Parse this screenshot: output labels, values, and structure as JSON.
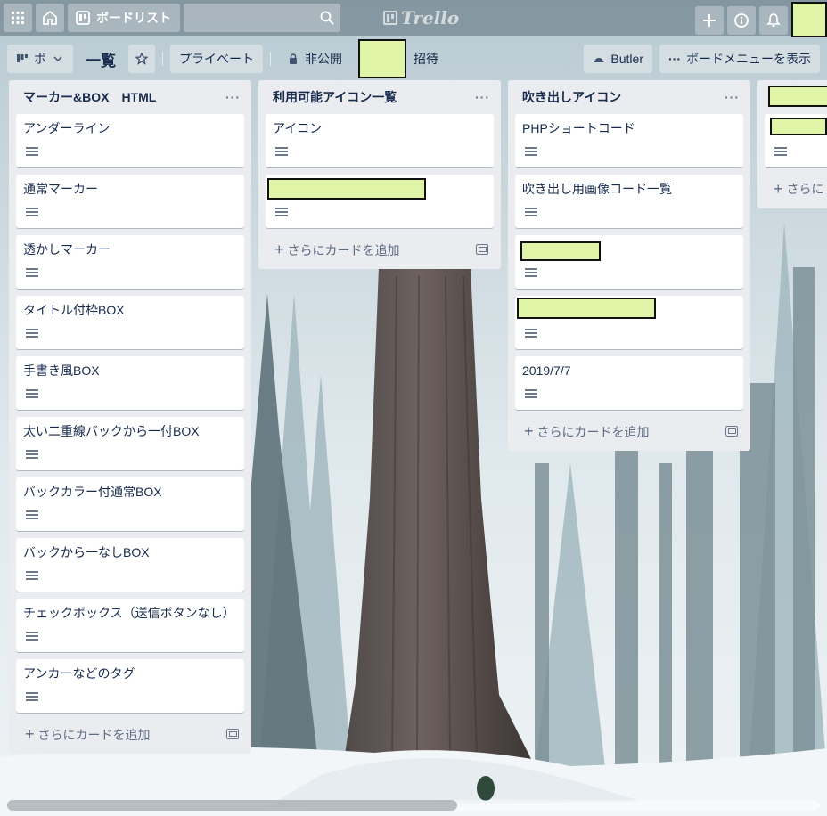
{
  "header": {
    "boards_label": "ボードリスト",
    "logo_text": "Trello"
  },
  "board": {
    "view_label": "ボ",
    "title": "一覧",
    "team_label": "プライベート",
    "visibility_label": "非公開",
    "invite_label": "招待",
    "butler_label": "Butler",
    "menu_label": "ボードメニューを表示"
  },
  "lists": [
    {
      "title": "マーカー&BOX　HTML",
      "menu": "···",
      "cards": [
        "アンダーライン",
        "通常マーカー",
        "透かしマーカー",
        "タイトル付枠BOX",
        "手書き風BOX",
        "太い二重線バックから一付BOX",
        "バックカラー付通常BOX",
        "バックから一なしBOX",
        "チェックボックス（送信ボタンなし）",
        "アンカーなどのタグ"
      ],
      "add_label": "さらにカードを追加"
    },
    {
      "title": "利用可能アイコン一覧",
      "menu": "···",
      "cards": [
        "アイコン",
        ""
      ],
      "add_label": "さらにカードを追加"
    },
    {
      "title": "吹き出しアイコン",
      "menu": "···",
      "cards": [
        "PHPショートコード",
        "吹き出し用画像コード一覧",
        "",
        "",
        "2019/7/7"
      ],
      "add_label": "さらにカードを追加"
    },
    {
      "add_label": "さらに"
    }
  ]
}
